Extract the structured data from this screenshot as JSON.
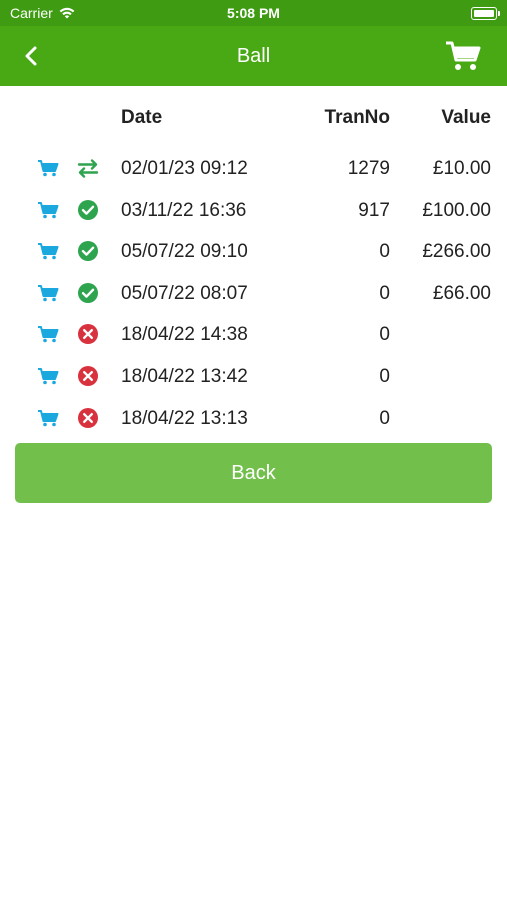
{
  "status_bar": {
    "carrier": "Carrier",
    "time": "5:08 PM"
  },
  "navbar": {
    "title": "Ball"
  },
  "table": {
    "headers": {
      "date": "Date",
      "tranno": "TranNo",
      "value": "Value"
    },
    "rows": [
      {
        "status": "transfer",
        "date": "02/01/23 09:12",
        "tranno": "1279",
        "value": "£10.00"
      },
      {
        "status": "success",
        "date": "03/11/22 16:36",
        "tranno": "917",
        "value": "£100.00"
      },
      {
        "status": "success",
        "date": "05/07/22 09:10",
        "tranno": "0",
        "value": "£266.00"
      },
      {
        "status": "success",
        "date": "05/07/22 08:07",
        "tranno": "0",
        "value": "£66.00"
      },
      {
        "status": "failed",
        "date": "18/04/22 14:38",
        "tranno": "0",
        "value": ""
      },
      {
        "status": "failed",
        "date": "18/04/22 13:42",
        "tranno": "0",
        "value": ""
      },
      {
        "status": "failed",
        "date": "18/04/22 13:13",
        "tranno": "0",
        "value": ""
      }
    ]
  },
  "back_button": {
    "label": "Back"
  },
  "colors": {
    "status_bar_bg": "#3e9b12",
    "navbar_bg": "#48a914",
    "button_bg": "#72bf4c",
    "cart_icon": "#1ba8df",
    "success": "#2ea44f",
    "failed": "#d9323f",
    "transfer": "#2ea44f"
  },
  "icons": {
    "back": "chevron-left-icon",
    "cart": "shopping-cart-icon",
    "wifi": "wifi-icon",
    "battery": "battery-icon",
    "success": "check-circle-icon",
    "failed": "x-circle-icon",
    "transfer": "transfer-arrows-icon"
  }
}
